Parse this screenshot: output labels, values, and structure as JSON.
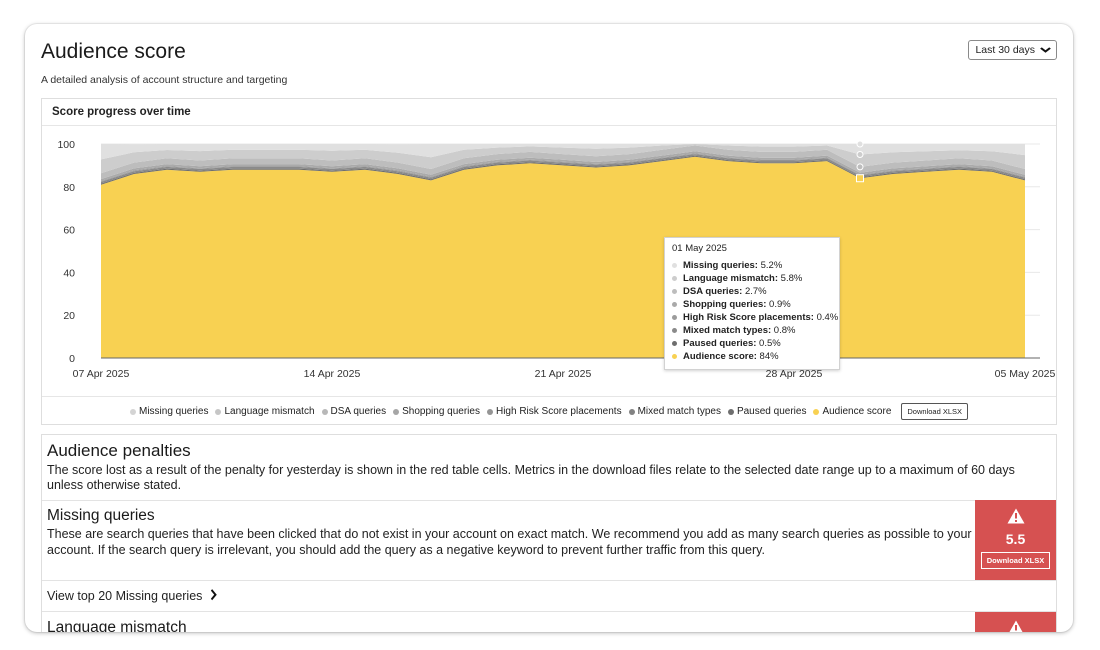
{
  "header": {
    "title": "Audience score",
    "subtitle": "A detailed analysis of account structure and targeting",
    "date_range": "Last 30 days"
  },
  "chart_panel": {
    "title": "Score progress over time",
    "download_label": "Download XLSX"
  },
  "chart_data": {
    "type": "area",
    "stacked": true,
    "title": "Score progress over time",
    "ylim": [
      0,
      100
    ],
    "yticks": [
      "0",
      "20",
      "40",
      "60",
      "80",
      "100"
    ],
    "x_tick_labels": [
      "07 Apr 2025",
      "14 Apr 2025",
      "21 Apr 2025",
      "28 Apr 2025",
      "05 May 2025"
    ],
    "x_tick_indices": [
      0,
      7,
      14,
      21,
      28
    ],
    "x": [
      "07 Apr",
      "08 Apr",
      "09 Apr",
      "10 Apr",
      "11 Apr",
      "12 Apr",
      "13 Apr",
      "14 Apr",
      "15 Apr",
      "16 Apr",
      "17 Apr",
      "18 Apr",
      "19 Apr",
      "20 Apr",
      "21 Apr",
      "22 Apr",
      "23 Apr",
      "24 Apr",
      "25 Apr",
      "26 Apr",
      "27 Apr",
      "28 Apr",
      "29 Apr",
      "30 Apr",
      "01 May",
      "02 May",
      "03 May",
      "04 May",
      "05 May"
    ],
    "series": [
      {
        "name": "Audience score",
        "color": "#f8d152",
        "values": [
          81,
          86,
          88,
          87,
          88,
          88,
          88,
          87,
          88,
          86,
          83,
          88,
          90,
          91,
          90,
          89,
          90,
          92,
          94,
          92,
          91,
          91,
          92,
          84,
          86,
          87,
          88,
          87,
          83
        ]
      },
      {
        "name": "Paused queries",
        "color": "#6e6e6e",
        "values": [
          0.5,
          0.5,
          0.5,
          0.5,
          0.5,
          0.5,
          0.5,
          0.5,
          0.5,
          0.5,
          0.5,
          0.5,
          0.5,
          0.5,
          0.5,
          0.5,
          0.5,
          0.5,
          0.5,
          0.5,
          0.5,
          0.5,
          0.5,
          0.5,
          0.5,
          0.5,
          0.5,
          0.5,
          0.5
        ]
      },
      {
        "name": "Mixed match types",
        "color": "#8a8a8a",
        "values": [
          0.8,
          0.8,
          0.8,
          0.8,
          0.8,
          0.8,
          0.8,
          0.8,
          0.8,
          0.8,
          0.8,
          0.8,
          0.8,
          0.8,
          0.8,
          0.8,
          0.8,
          0.8,
          0.8,
          0.8,
          0.8,
          0.8,
          0.8,
          0.8,
          0.8,
          0.8,
          0.8,
          0.8,
          0.8
        ]
      },
      {
        "name": "High Risk Score placements",
        "color": "#9c9c9c",
        "values": [
          0.4,
          0.4,
          0.4,
          0.4,
          0.4,
          0.4,
          0.4,
          0.4,
          0.4,
          0.4,
          0.4,
          0.4,
          0.4,
          0.4,
          0.4,
          0.4,
          0.4,
          0.4,
          0.4,
          0.4,
          0.4,
          0.4,
          0.4,
          0.4,
          0.4,
          0.4,
          0.4,
          0.4,
          0.4
        ]
      },
      {
        "name": "Shopping queries",
        "color": "#aaaaaa",
        "values": [
          0.9,
          0.9,
          0.9,
          0.9,
          0.9,
          0.9,
          0.9,
          0.9,
          0.9,
          0.9,
          0.9,
          0.9,
          0.9,
          0.9,
          0.9,
          0.9,
          0.9,
          0.9,
          0.9,
          0.9,
          0.9,
          0.9,
          0.9,
          0.9,
          0.9,
          0.9,
          0.9,
          0.9,
          0.9
        ]
      },
      {
        "name": "DSA queries",
        "color": "#bdbdbd",
        "values": [
          2.7,
          2.7,
          2.7,
          2.7,
          2.7,
          2.7,
          2.7,
          2.7,
          2.7,
          2.7,
          2.7,
          2.7,
          2.7,
          2.7,
          2.7,
          2.7,
          2.7,
          2.7,
          2.7,
          2.7,
          2.7,
          2.7,
          2.7,
          2.7,
          2.7,
          2.7,
          2.7,
          2.7,
          2.7
        ]
      },
      {
        "name": "Language mismatch",
        "color": "#cdcdcd",
        "values": [
          6.5,
          4.8,
          3.9,
          4.4,
          4.0,
          4.0,
          4.0,
          4.5,
          4.0,
          4.6,
          5.5,
          4.0,
          3.0,
          2.6,
          3.0,
          3.5,
          3.0,
          2.0,
          1.0,
          2.0,
          2.5,
          2.5,
          2.0,
          5.8,
          4.8,
          4.3,
          3.8,
          4.3,
          6.5
        ]
      },
      {
        "name": "Missing queries",
        "color": "#e0e0e0",
        "values": [
          7.2,
          3.8,
          2.8,
          3.3,
          2.7,
          2.7,
          2.7,
          3.2,
          2.7,
          4.0,
          6.2,
          2.7,
          1.7,
          1.1,
          1.7,
          2.2,
          1.7,
          0.7,
          0.0,
          1.1,
          1.6,
          1.6,
          0.7,
          5.2,
          3.9,
          3.4,
          2.9,
          3.4,
          5.2
        ]
      }
    ],
    "hover_index": 23,
    "legend_position": "bottom",
    "grid": true
  },
  "tooltip": {
    "date": "01 May 2025",
    "rows": [
      {
        "label": "Missing queries:",
        "value": "5.2%",
        "color": "#e0e0e0"
      },
      {
        "label": "Language mismatch:",
        "value": "5.8%",
        "color": "#cdcdcd"
      },
      {
        "label": "DSA queries:",
        "value": "2.7%",
        "color": "#bdbdbd"
      },
      {
        "label": "Shopping queries:",
        "value": "0.9%",
        "color": "#aaaaaa"
      },
      {
        "label": "High Risk Score placements:",
        "value": "0.4%",
        "color": "#9c9c9c"
      },
      {
        "label": "Mixed match types:",
        "value": "0.8%",
        "color": "#8a8a8a"
      },
      {
        "label": "Paused queries:",
        "value": "0.5%",
        "color": "#6e6e6e"
      },
      {
        "label": "Audience score:",
        "value": "84%",
        "color": "#f8d152"
      }
    ]
  },
  "legend": [
    {
      "label": "Missing queries",
      "color": "#d4d4d4"
    },
    {
      "label": "Language mismatch",
      "color": "#c6c6c6"
    },
    {
      "label": "DSA queries",
      "color": "#b8b8b8"
    },
    {
      "label": "Shopping queries",
      "color": "#a6a6a6"
    },
    {
      "label": "High Risk Score placements",
      "color": "#959595"
    },
    {
      "label": "Mixed match types",
      "color": "#828282"
    },
    {
      "label": "Paused queries",
      "color": "#6e6e6e"
    },
    {
      "label": "Audience score",
      "color": "#f8d152"
    }
  ],
  "penalties": {
    "title": "Audience penalties",
    "description": "The score lost as a result of the penalty for yesterday is shown in the red table cells. Metrics in the download files relate to the selected date range up to a maximum of 60 days unless otherwise stated.",
    "items": [
      {
        "title": "Missing queries",
        "description": "These are search queries that have been clicked that do not exist in your account on exact match. We recommend you add as many search queries as possible to your account. If the search query is irrelevant, you should add the query as a negative keyword to prevent further traffic from this query.",
        "score": "5.5",
        "download_label": "Download XLSX",
        "view_link": "View top 20 Missing queries"
      },
      {
        "title": "Language mismatch"
      }
    ]
  },
  "colors": {
    "penalty_red": "#d65151",
    "score_yellow": "#f8d152"
  }
}
